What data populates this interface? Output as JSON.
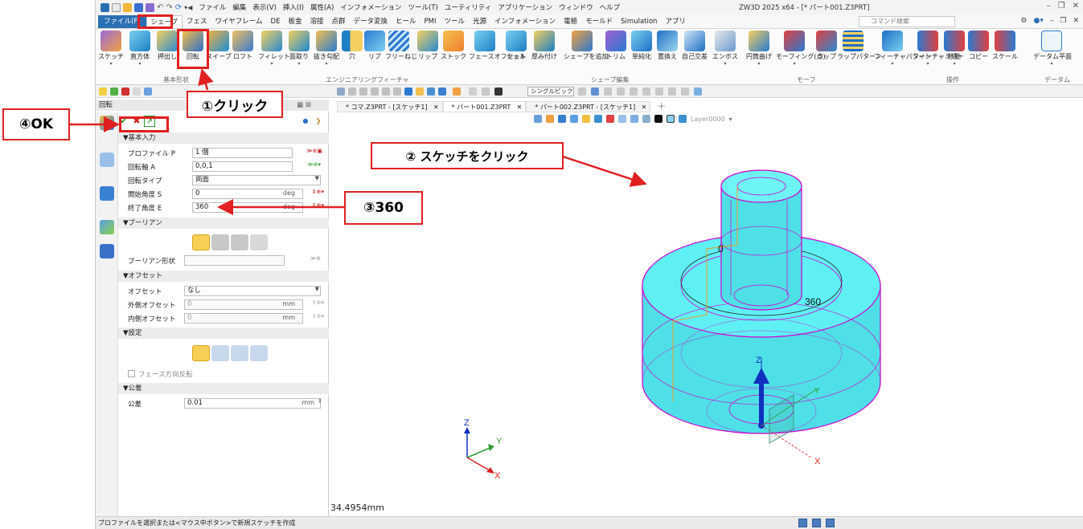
{
  "menu": {
    "items": [
      "ファイル",
      "編集",
      "表示(V)",
      "挿入(I)",
      "属性(A)",
      "インフォメーション",
      "ツール(T)",
      "ユーティリティ",
      "アプリケーション",
      "ウィンドウ",
      "ヘルプ"
    ],
    "window_title": "ZW3D 2025 x64 - [* パート001.Z3PRT]"
  },
  "ribbon_tabs": {
    "file": "ファイル(F)",
    "items": [
      "シェープ",
      "フェス",
      "ワイヤフレーム",
      "DE",
      "板金",
      "溶接",
      "点群",
      "データ変換",
      "ヒール",
      "PMI",
      "ツール",
      "光源",
      "インフォメーション",
      "電極",
      "モールド",
      "Simulation",
      "アプリ"
    ],
    "command_search_placeholder": "コマンド検索"
  },
  "ribbon": {
    "buttons": [
      "スケッチ",
      "直方体",
      "押出し",
      "回転",
      "スイープ",
      "ロフト",
      "フィレット",
      "面取り",
      "抜き勾配",
      "穴",
      "リブ",
      "フリーねじ",
      "リップ",
      "ストック",
      "フェースオフセット",
      "シェル",
      "厚み付け",
      "シェープを追加",
      "トリム",
      "単純化",
      "置換え",
      "自己交差",
      "エンボス",
      "円筒曲げ",
      "モーフィング(点)",
      "ラップ",
      "ラップパターン",
      "フィーチャパターン",
      "フィーチャミラー",
      "移動",
      "コピー",
      "スケール",
      "データム平面"
    ],
    "groups": [
      "基本形状",
      "エンジニアリングフィーチャ",
      "シェープ編集",
      "モーフ",
      "操作",
      "データム"
    ]
  },
  "toolbar": {
    "pick_mode": "シングルピック"
  },
  "panel": {
    "title": "回転",
    "sections": {
      "basic": "▼基本入力",
      "boolean": "▼ブーリアン",
      "offset": "▼オフセット",
      "settings": "▼設定",
      "tolerance": "▼公差"
    },
    "fields": {
      "profile_label": "プロファイル P",
      "profile_value": "1 個",
      "axis_label": "回転軸 A",
      "axis_value": "0,0,1",
      "type_label": "回転タイプ",
      "type_value": "両面",
      "start_label": "開始角度 S",
      "start_value": "0",
      "start_unit": "deg",
      "end_label": "終了角度 E",
      "end_value": "360",
      "end_unit": "deg",
      "bool_shape_label": "ブーリアン形状",
      "offset_label": "オフセット",
      "offset_value": "なし",
      "outer_label": "外側オフセット",
      "outer_value": "0",
      "outer_unit": "mm",
      "inner_label": "内側オフセット",
      "inner_value": "0",
      "inner_unit": "mm",
      "flip_label": "フェース方向反転",
      "tol_label": "公差",
      "tol_value": "0.01",
      "tol_unit": "mm"
    }
  },
  "doc_tabs": [
    {
      "label": "* コマ.Z3PRT - [スケッチ1]"
    },
    {
      "label": "* パート001.Z3PRT"
    },
    {
      "label": "* パート002.Z3PRT - [スケッチ1]"
    }
  ],
  "viewport": {
    "layer": "Layer0000",
    "dim_start": "0",
    "dim_end": "360",
    "measurement": "34.4954mm",
    "axis_x": "X",
    "axis_y": "Y",
    "axis_z": "Z"
  },
  "status": {
    "message": "プロファイルを選択または<マウス中ボタン>で新規スケッチを作成"
  },
  "annotations": {
    "step1": "①クリック",
    "step2": "② スケッチをクリック",
    "step3": "③360",
    "step4": "④OK"
  },
  "colors": {
    "annotation_red": "#e02020",
    "solid_fill": "#4ee0e6",
    "edge_magenta": "#d100d1"
  }
}
